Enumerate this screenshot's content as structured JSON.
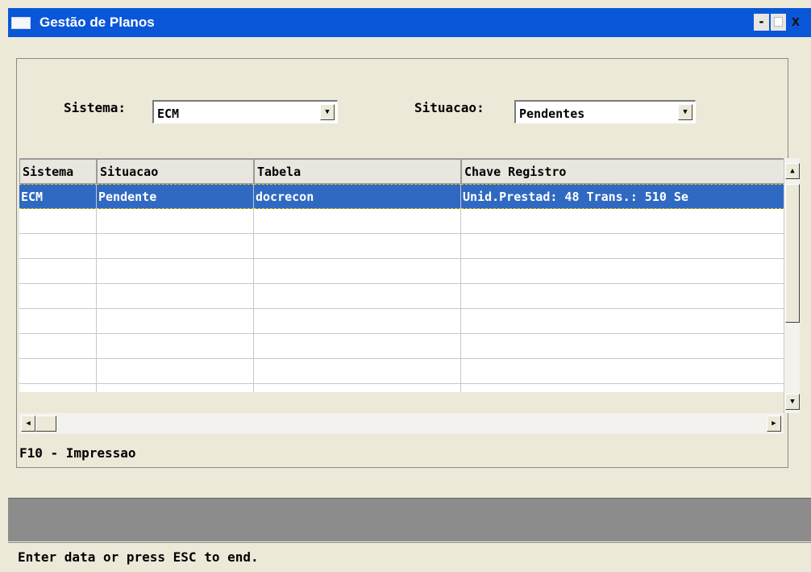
{
  "window": {
    "title": "Gestão de Planos",
    "minimize_glyph": "-",
    "close_glyph": "x"
  },
  "filters": {
    "sistema_label": "Sistema:",
    "sistema_value": "ECM",
    "situacao_label": "Situacao:",
    "situacao_value": "Pendentes"
  },
  "table": {
    "columns": [
      "Sistema",
      "Situacao",
      "Tabela",
      "Chave Registro"
    ],
    "rows": [
      [
        "ECM",
        "Pendente",
        "docrecon",
        " Unid.Prestad: 48 Trans.: 510 Se"
      ]
    ],
    "selected_row": 0
  },
  "footer": {
    "hint": "F10 - Impressao",
    "status": "Enter data or press ESC to end."
  },
  "icons": {
    "dropdown": "triangle-down-icon",
    "scroll_up": "triangle-up-icon",
    "scroll_down": "triangle-down-icon",
    "scroll_left": "triangle-left-icon",
    "scroll_right": "triangle-right-icon"
  },
  "colors": {
    "titlebar": "#0a56d8",
    "selection": "#2f69c2",
    "background": "#ece9d8"
  }
}
